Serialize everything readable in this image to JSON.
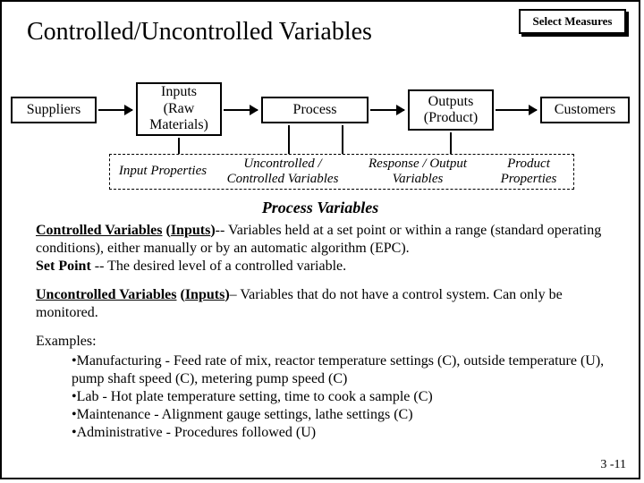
{
  "title": "Controlled/Uncontrolled Variables",
  "badge": "Select Measures",
  "flow": {
    "b1": "Suppliers",
    "b2": "Inputs\n(Raw\nMaterials)",
    "b3": "Process",
    "b4": "Outputs\n(Product)",
    "b5": "Customers"
  },
  "dash": {
    "d1": "Input Properties",
    "d2": "Uncontrolled /\nControlled Variables",
    "d3": "Response / Output\nVariables",
    "d4": "Product\nProperties"
  },
  "pv_heading": "Process Variables",
  "p1": {
    "lead_u": "Controlled Variables",
    "lead_paren_open": " (",
    "lead_inputs": "Inputs",
    "lead_paren_close": ")",
    "rest": "-- Variables held at a set point or within a range (standard operating conditions), either manually or by an automatic algorithm (EPC).",
    "sp_label": "Set Point",
    "sp_rest": " -- The desired level of a controlled variable."
  },
  "p2": {
    "lead_u": "Uncontrolled Variables",
    "lead_paren_open": " (",
    "lead_inputs": "Inputs",
    "lead_paren_close": ")",
    "rest": "– Variables that do not have a control system. Can only be monitored."
  },
  "ex": {
    "head": "Examples:",
    "b1": "•Manufacturing - Feed rate of mix, reactor temperature settings (C), outside temperature (U), pump shaft speed (C), metering pump speed (C)",
    "b2": "•Lab - Hot plate temperature setting, time to cook a sample (C)",
    "b3": "•Maintenance - Alignment gauge settings, lathe settings (C)",
    "b4": "•Administrative - Procedures followed (U)"
  },
  "pagenum": "3 -11"
}
